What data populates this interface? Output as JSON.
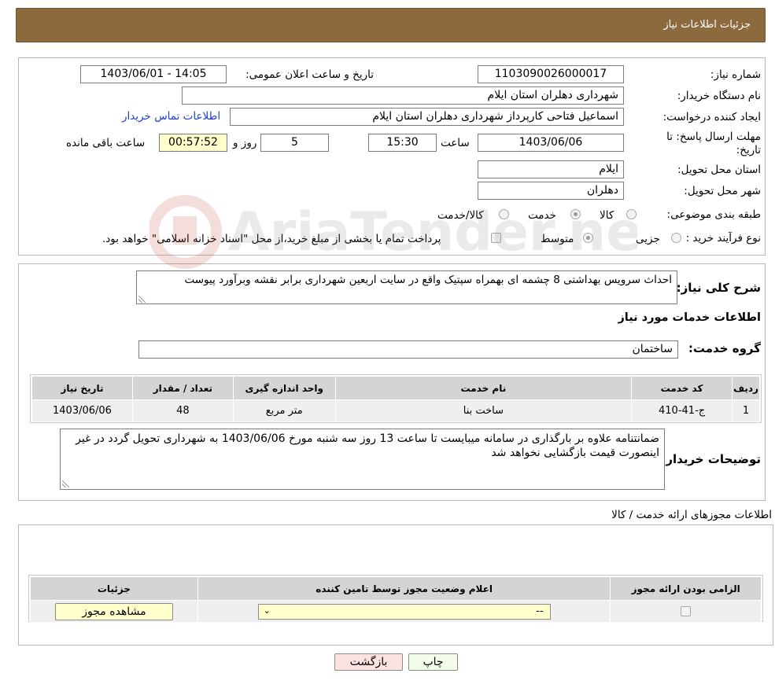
{
  "header": {
    "title": "جزئیات اطلاعات نیاز"
  },
  "need_info": {
    "need_number_label": "شماره نیاز:",
    "need_number": "1103090026000017",
    "announce_label": "تاریخ و ساعت اعلان عمومی:",
    "announce_value": "1403/06/01 - 14:05",
    "buyer_org_label": "نام دستگاه خریدار:",
    "buyer_org": "شهرداری دهلران استان ایلام",
    "creator_label": "ایجاد کننده درخواست:",
    "creator": "اسماعیل فتاحی کارپرداز شهرداری دهلران استان ایلام",
    "contact_link": "اطلاعات تماس خریدار",
    "deadline_label_1": "مهلت ارسال پاسخ: تا",
    "deadline_label_2": "تاریخ:",
    "deadline_date": "1403/06/06",
    "time_label": "ساعت",
    "deadline_time": "15:30",
    "days": "5",
    "days_label": "روز و",
    "remaining": "00:57:52",
    "remaining_label": "ساعت باقی مانده",
    "province_label": "استان محل تحویل:",
    "province": "ایلام",
    "city_label": "شهر محل تحویل:",
    "city": "دهلران",
    "category_label": "طبقه بندی موضوعی:",
    "category_options": [
      "کالا",
      "خدمت",
      "کالا/خدمت"
    ],
    "category_selected": "خدمت",
    "purchase_type_label": "نوع فرآیند خرید :",
    "purchase_options": [
      "جزیی",
      "متوسط"
    ],
    "purchase_selected": "متوسط",
    "payment_note": "پرداخت تمام یا بخشی از مبلغ خرید،از محل \"اسناد خزانه اسلامی\" خواهد بود."
  },
  "description": {
    "label": "شرح کلی نیاز:",
    "text": "احداث سرویس بهداشتی 8 چشمه ای بهمراه سپتیک واقع در سایت اربعین شهرداری برابر نقشه وبرآورد پیوست"
  },
  "services": {
    "section_title": "اطلاعات خدمات مورد نیاز",
    "group_label": "گروه خدمت:",
    "group_value": "ساختمان",
    "columns": [
      "ردیف",
      "کد خدمت",
      "نام خدمت",
      "واحد اندازه گیری",
      "تعداد / مقدار",
      "تاریخ نیاز"
    ],
    "rows": [
      {
        "row": "1",
        "code": "ج-41-410",
        "name": "ساخت بنا",
        "unit": "متر مربع",
        "qty": "48",
        "date": "1403/06/06"
      }
    ]
  },
  "buyer_notes": {
    "label": "توضیحات خریدار:",
    "text": "ضمانتنامه علاوه بر بارگذاری در سامانه میبایست تا ساعت 13 روز سه شنبه مورخ 1403/06/06 به شهرداری تحویل گردد در غیر اینصورت قیمت بازگشایی نخواهد شد"
  },
  "permits": {
    "section_title": "اطلاعات مجوزهای ارائه خدمت / کالا",
    "columns": [
      "الزامی بودن ارائه مجوز",
      "اعلام وضعیت مجوز توسط تامین کننده",
      "جزئیات"
    ],
    "select_value": "--",
    "view_button": "مشاهده مجوز"
  },
  "actions": {
    "print": "چاپ",
    "back": "بازگشت"
  },
  "watermark": {
    "text": "AriaTender.neT"
  }
}
